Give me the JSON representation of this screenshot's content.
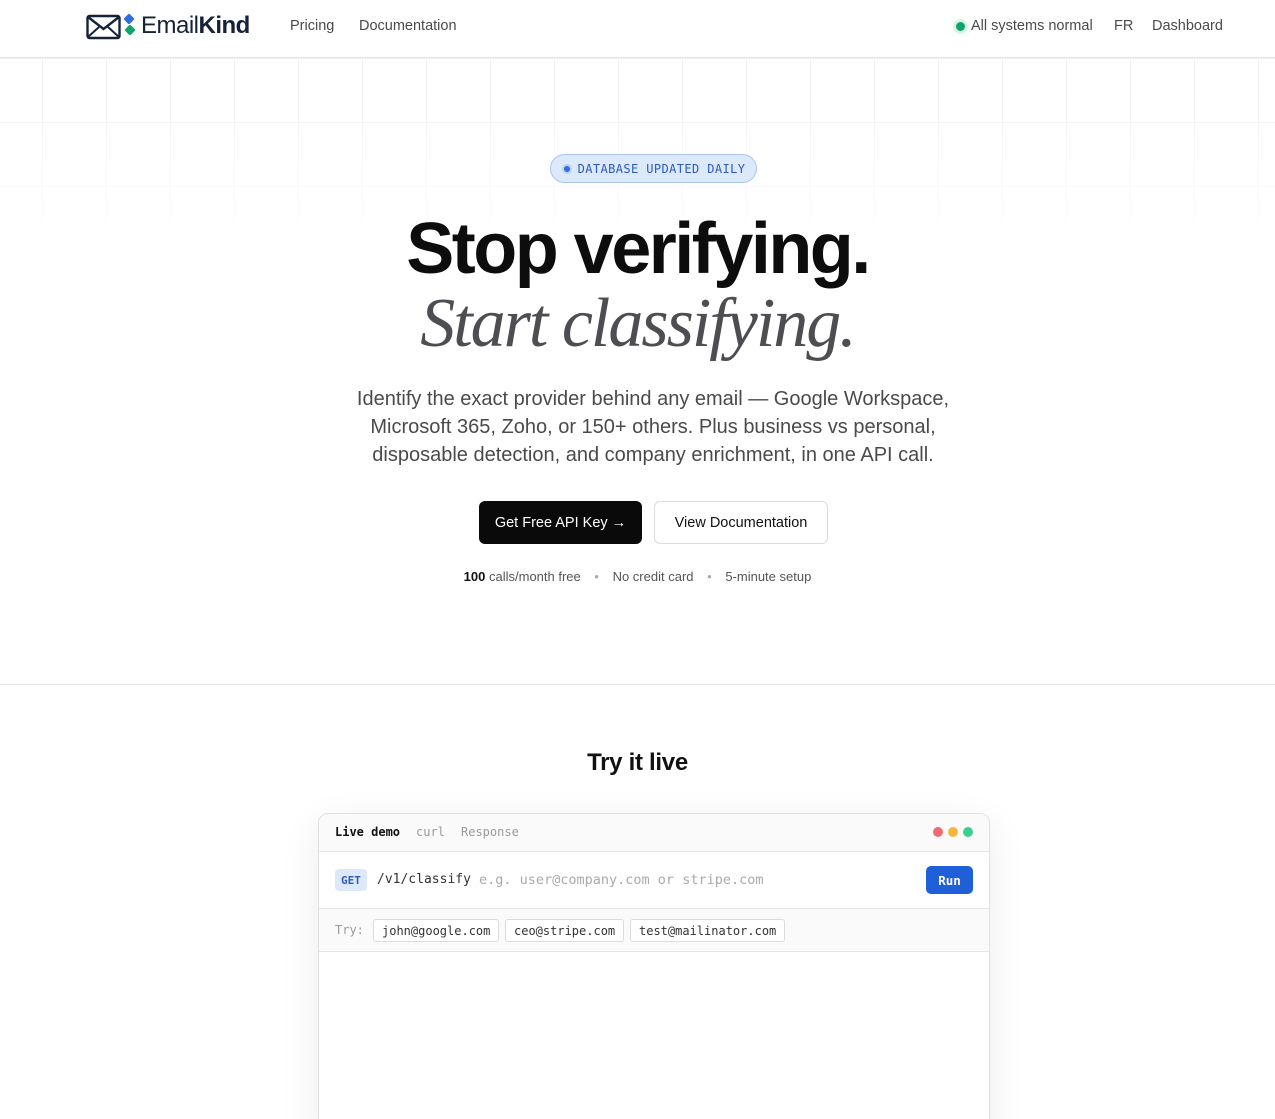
{
  "nav": {
    "logo_prefix": "Email",
    "logo_suffix": "Kind",
    "links": [
      "Pricing",
      "Documentation"
    ],
    "status_text": "All systems normal",
    "lang": "FR",
    "dashboard": "Dashboard",
    "status_color": "#10a36b"
  },
  "hero": {
    "badge": "DATABASE UPDATED DAILY",
    "title": "Stop verifying.",
    "subtitle": "Start classifying.",
    "lead": "Identify the exact provider behind any email — Google Workspace, Microsoft 365, Zoho, or 150+ others. Plus business vs personal, disposable detection, and company enrichment, in one API call.",
    "cta_primary": "Get Free API Key →",
    "cta_secondary": "View Documentation",
    "meta": {
      "calls_count": "100",
      "calls_text": "calls/month free",
      "no_card": "No credit card",
      "setup": "5-minute setup"
    }
  },
  "demo": {
    "section_title": "Try it live",
    "tabs": [
      "Live demo",
      "curl",
      "Response"
    ],
    "method": "GET",
    "endpoint": "/v1/classify",
    "placeholder": "e.g. user@company.com or stripe.com",
    "run_label": "Run",
    "try_label": "Try:",
    "examples": [
      "john@google.com",
      "ceo@stripe.com",
      "test@mailinator.com"
    ],
    "window_dot_colors": [
      "#ef6b73",
      "#f5b73b",
      "#3ccf8e"
    ],
    "accent_color": "#1f5fd8"
  }
}
